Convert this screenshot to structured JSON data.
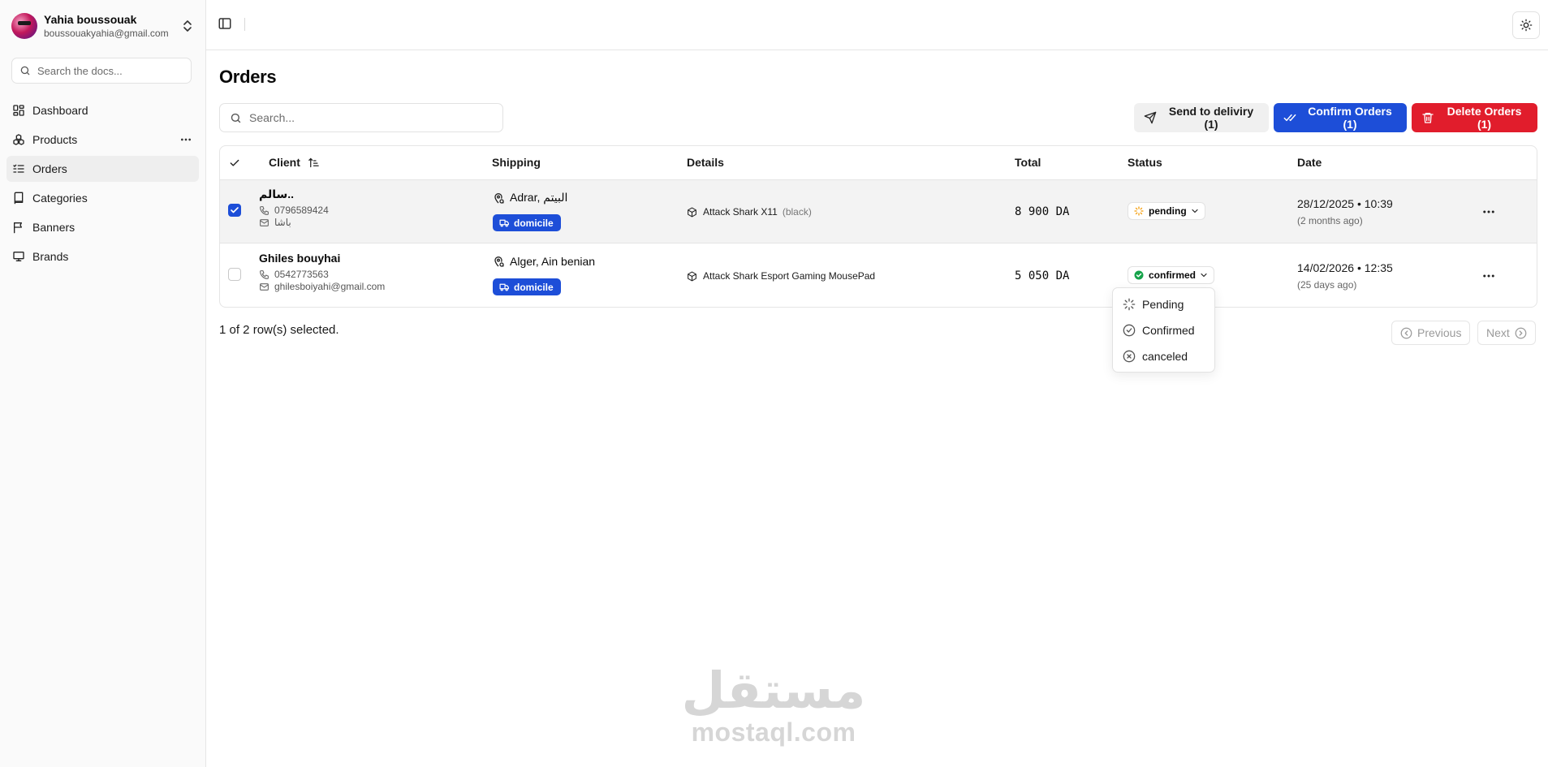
{
  "sidebar": {
    "user": {
      "name": "Yahia boussouak",
      "email": "boussouakyahia@gmail.com"
    },
    "search_placeholder": "Search the docs...",
    "items": [
      {
        "label": "Dashboard",
        "icon": "dashboard-icon"
      },
      {
        "label": "Products",
        "icon": "boxes-icon"
      },
      {
        "label": "Orders",
        "icon": "list-icon",
        "active": true
      },
      {
        "label": "Categories",
        "icon": "book-icon"
      },
      {
        "label": "Banners",
        "icon": "flag-icon"
      },
      {
        "label": "Brands",
        "icon": "presentation-icon"
      }
    ]
  },
  "main": {
    "title": "Orders",
    "search_placeholder": "Search...",
    "actions": {
      "send": "Send to deliviry (1)",
      "confirm": "Confirm Orders (1)",
      "delete": "Delete Orders (1)"
    }
  },
  "table": {
    "headers": {
      "client": "Client",
      "shipping": "Shipping",
      "details": "Details",
      "total": "Total",
      "status": "Status",
      "date": "Date"
    },
    "rows": [
      {
        "selected": true,
        "client_name": "سالم..",
        "phone": "0796589424",
        "email": "باشا",
        "city": "Adrar, البيتم",
        "shipping_type": "domicile",
        "product": "Attack Shark X11",
        "variant": "(black)",
        "total": "8 900 DA",
        "status": "pending",
        "date": "28/12/2025 • 10:39",
        "date_relative": "(2 months ago)"
      },
      {
        "selected": false,
        "client_name": "Ghiles bouyhai",
        "phone": "0542773563",
        "email": "ghilesboiyahi@gmail.com",
        "city": "Alger, Ain benian",
        "shipping_type": "domicile",
        "product": "Attack Shark Esport Gaming MousePad",
        "variant": "",
        "total": "5 050 DA",
        "status": "confirmed",
        "date": "14/02/2026 • 12:35",
        "date_relative": "(25 days ago)"
      }
    ]
  },
  "status_menu": {
    "options": [
      "Pending",
      "Confirmed",
      "canceled"
    ]
  },
  "footer": {
    "selection": "1 of 2 row(s) selected.",
    "previous": "Previous",
    "next": "Next"
  },
  "watermark": {
    "arabic": "مستقل",
    "latin": "mostaql.com"
  },
  "colors": {
    "primary_blue": "#1d4ed8",
    "danger_red": "#e11d2c",
    "pending": "#f59e0b",
    "confirmed": "#16a34a"
  }
}
